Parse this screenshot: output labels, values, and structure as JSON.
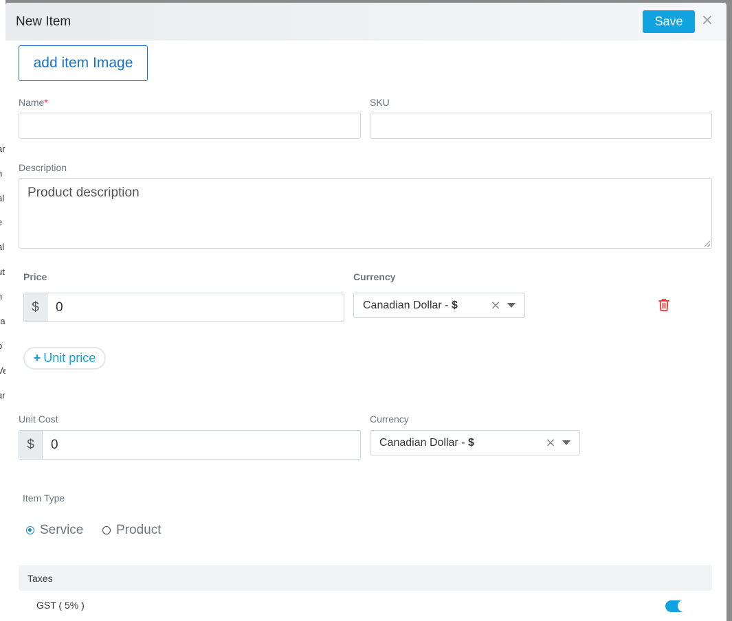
{
  "modal": {
    "title": "New Item",
    "save_label": "Save",
    "close_glyph": "×",
    "add_image_label": "add item Image"
  },
  "fields": {
    "name_label": "Name",
    "name_required": "*",
    "name_value": "",
    "sku_label": "SKU",
    "sku_value": "",
    "description_label": "Description",
    "description_placeholder": "Product description"
  },
  "price": {
    "label": "Price",
    "currency_symbol": "$",
    "value": "0",
    "currency_label": "Currency",
    "currency_name": "Canadian Dollar - ",
    "currency_sym": "$",
    "clear_glyph": "×",
    "delete_icon": "trash-icon",
    "unit_price_plus": "+",
    "unit_price_label": "Unit price"
  },
  "unit_cost": {
    "label": "Unit Cost",
    "currency_symbol": "$",
    "value": "0",
    "currency_label": "Currency",
    "currency_name": "Canadian Dollar - ",
    "currency_sym": "$",
    "clear_glyph": "×"
  },
  "item_type": {
    "label": "Item Type",
    "options": [
      {
        "label": "Service",
        "selected": true
      },
      {
        "label": "Product",
        "selected": false
      }
    ]
  },
  "taxes": {
    "title": "Taxes",
    "items": [
      {
        "name": "GST ( 5% )",
        "enabled": true
      }
    ]
  },
  "colors": {
    "accent": "#10a3e0",
    "link": "#1572c9",
    "danger": "#dc3545"
  }
}
